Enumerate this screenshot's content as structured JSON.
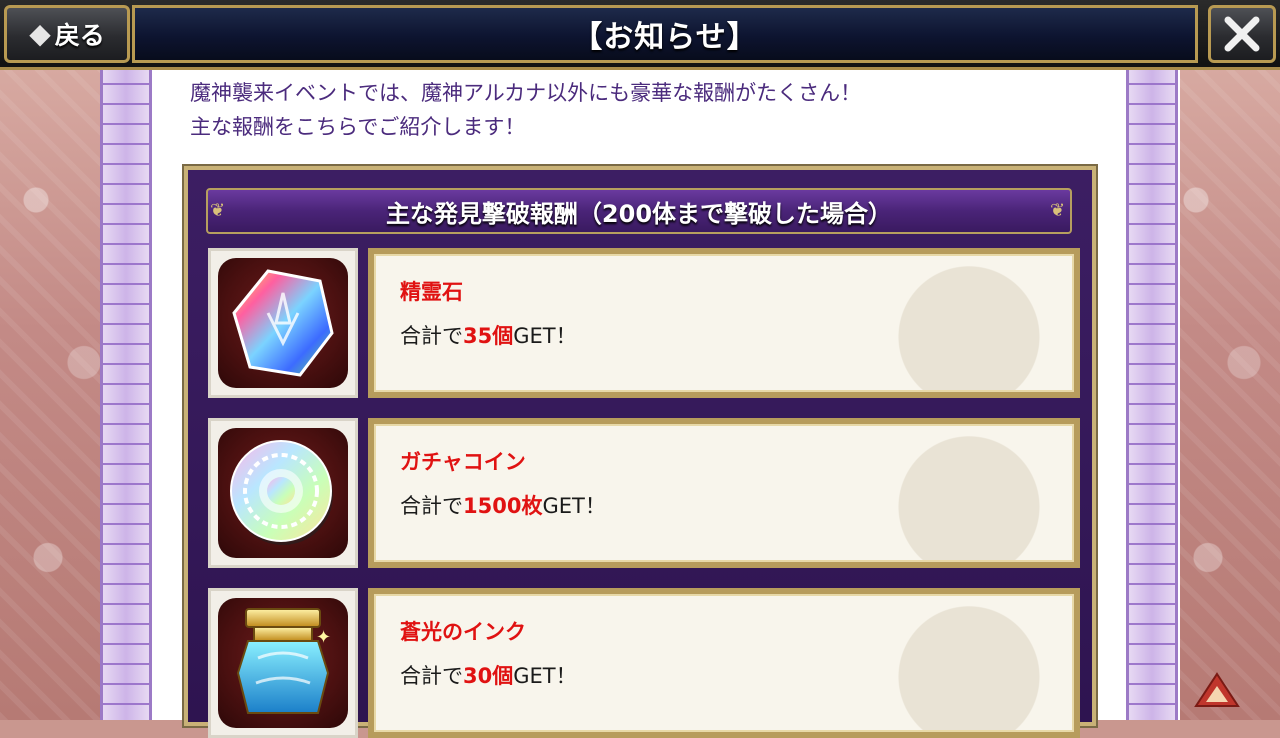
{
  "header": {
    "back_label": "戻る",
    "title": "【お知らせ】"
  },
  "intro": {
    "line1": "魔神襲来イベントでは、魔神アルカナ以外にも豪華な報酬がたくさん！",
    "line2": "主な報酬をこちらでご紹介します！"
  },
  "rewards": {
    "title": "主な発見撃破報酬（200体まで撃破した場合）",
    "items": [
      {
        "name": "精霊石",
        "desc_prefix": "合計で",
        "amount": "35個",
        "desc_suffix": "GET！",
        "icon": "rainbow-crystal-icon"
      },
      {
        "name": "ガチャコイン",
        "desc_prefix": "合計で",
        "amount": "1500枚",
        "desc_suffix": "GET！",
        "icon": "gacha-coin-icon"
      },
      {
        "name": "蒼光のインク",
        "desc_prefix": "合計で",
        "amount": "30個",
        "desc_suffix": "GET！",
        "icon": "ink-jar-icon"
      }
    ]
  },
  "colors": {
    "accent_red": "#e01212",
    "panel_purple": "#3c1e63",
    "gold_border": "#b79c5c",
    "intro_text": "#4b2b7d"
  }
}
